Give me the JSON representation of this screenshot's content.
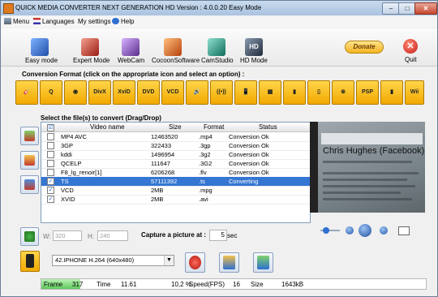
{
  "window": {
    "title": "QUICK MEDIA CONVERTER NEXT GENERATION HD Version : 4.0.0.20 Easy Mode",
    "min": "–",
    "max": "□",
    "close": "✕"
  },
  "menu": [
    "Menu",
    "Languages",
    "My settings",
    "Help"
  ],
  "toolbar": [
    {
      "label": "Easy mode",
      "icon": "easy-mode-icon",
      "color": "#3a7bd5"
    },
    {
      "label": "Expert Mode",
      "icon": "tools-icon",
      "color": "#c0392b"
    },
    {
      "label": "WebCam",
      "icon": "webcam-icon",
      "color": "#8e44ad"
    },
    {
      "label": "CocoonSoftware",
      "icon": "cocoon-icon",
      "color": "#d35400"
    },
    {
      "label": "CamStudio",
      "icon": "camstudio-icon",
      "color": "#16a085"
    },
    {
      "label": "HD Mode",
      "icon": "hd-icon",
      "color": "#34495e"
    }
  ],
  "donate": "Donate",
  "quit": "Quit",
  "conversion_heading": "Conversion Format (click on the appropriate icon and select an option) :",
  "formats": [
    "🎸",
    "Q",
    "◉",
    "DivX",
    "XviD",
    "DVD",
    "VCD",
    "🔊",
    "((•))",
    "📱",
    "▦",
    "▮",
    "▯",
    "⊗",
    "PSP",
    "▮",
    "Wii",
    "▭"
  ],
  "files_heading": "Select  the  file(s) to convert (Drag/Drop)",
  "table": {
    "columns": [
      "",
      "Video name",
      "Size",
      "Format",
      "Status"
    ],
    "rows": [
      {
        "checked": false,
        "name": "MP4 AVC",
        "size": "12463520",
        "format": ".mp4",
        "status": "Conversion Ok",
        "selected": false
      },
      {
        "checked": false,
        "name": "3GP",
        "size": "322433",
        "format": ".3gp",
        "status": "Conversion Ok",
        "selected": false
      },
      {
        "checked": false,
        "name": "kddi",
        "size": "1496954",
        "format": ".3g2",
        "status": "Conversion Ok",
        "selected": false
      },
      {
        "checked": false,
        "name": "QCELP",
        "size": "111647",
        "format": ".3G2",
        "status": "Conversion Ok",
        "selected": false
      },
      {
        "checked": false,
        "name": "F8_lg_renoir[1]",
        "size": "6206268",
        "format": ".flv",
        "status": "Conversion Ok",
        "selected": false
      },
      {
        "checked": true,
        "name": "TS",
        "size": "57111392",
        "format": ".ts",
        "status": "Converting",
        "selected": true
      },
      {
        "checked": true,
        "name": "VCD",
        "size": "2MB",
        "format": ".mpg",
        "status": "",
        "selected": false
      },
      {
        "checked": true,
        "name": "XVID",
        "size": "2MB",
        "format": ".avi",
        "status": "",
        "selected": false
      }
    ]
  },
  "preview": {
    "headline": "Chris Hughes (Facebook)"
  },
  "dimensions": {
    "w_label": "W:",
    "w_value": "320",
    "h_label": "H:",
    "h_value": "240"
  },
  "capture": {
    "label": "Capture a picture at :",
    "value": "5",
    "unit": "sec"
  },
  "profile": "42.IPHONE H.264 (640x480)",
  "status": {
    "frame_label": "Frame",
    "frame": "317",
    "time_label": "Time",
    "time": "11.61",
    "percent": "10,2 %",
    "speed_label": "Speed(FPS)",
    "speed": "16",
    "size_label": "Size",
    "size": "1643kB",
    "progress_fraction": 0.102
  }
}
